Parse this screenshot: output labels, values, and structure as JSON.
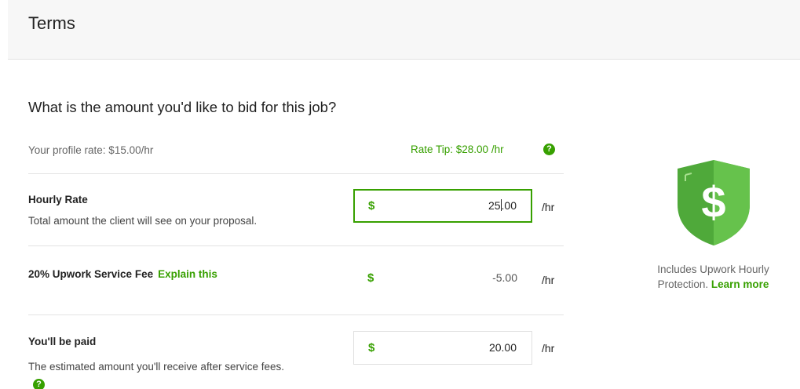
{
  "header": {
    "title": "Terms"
  },
  "question": "What is the amount you'd like to bid for this job?",
  "profile_rate": "Your profile rate: $15.00/hr",
  "rate_tip": "Rate Tip: $28.00 /hr",
  "hourly_rate": {
    "title": "Hourly Rate",
    "subtitle": "Total amount the client will see on your proposal.",
    "currency": "$",
    "value_before_caret": "25",
    "value_after_caret": ".00",
    "unit": "/hr"
  },
  "service_fee": {
    "title": "20% Upwork Service Fee",
    "explain_link": "Explain this",
    "currency": "$",
    "value": "-5.00",
    "unit": "/hr"
  },
  "paid": {
    "title": "You'll be paid",
    "subtitle": "The estimated amount you'll receive after service fees.",
    "currency": "$",
    "value": "20.00",
    "unit": "/hr"
  },
  "protection": {
    "text": "Includes Upwork Hourly Protection.",
    "learn_more": "Learn more",
    "badge_symbol": "$"
  },
  "help_glyph": "?",
  "colors": {
    "accent": "#37a000",
    "shield": "#5bbd3c",
    "shield_dark": "#3d9f2a"
  },
  "icons": {
    "help": "question-circle-icon",
    "shield": "dollar-shield-icon"
  }
}
